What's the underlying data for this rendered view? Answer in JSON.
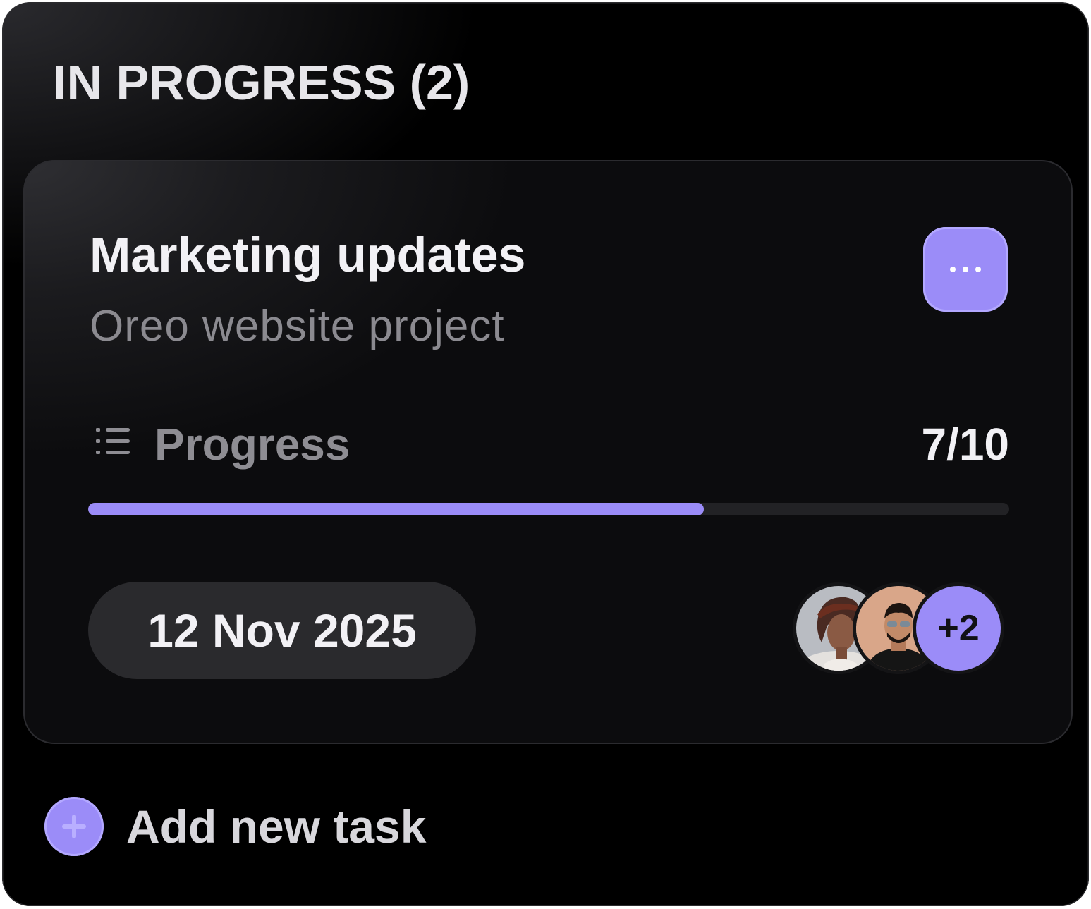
{
  "column": {
    "title": "IN PROGRESS (2)"
  },
  "card": {
    "title": "Marketing updates",
    "subtitle": "Oreo website project",
    "more_icon": "more-horizontal-icon",
    "progress": {
      "icon": "list-icon",
      "label": "Progress",
      "count": "7/10",
      "fraction": 0.7
    },
    "due_date": "12 Nov 2025",
    "assignees": {
      "avatars": [
        "avatar-woman",
        "avatar-man"
      ],
      "more_label": "+2"
    }
  },
  "add_task": {
    "icon": "plus-icon",
    "label": "Add new task"
  },
  "colors": {
    "accent": "#9b8cf8",
    "background": "#000000",
    "card": "#1b1b1e",
    "text_primary": "#f2f1f5",
    "text_muted": "#8b8a90"
  }
}
